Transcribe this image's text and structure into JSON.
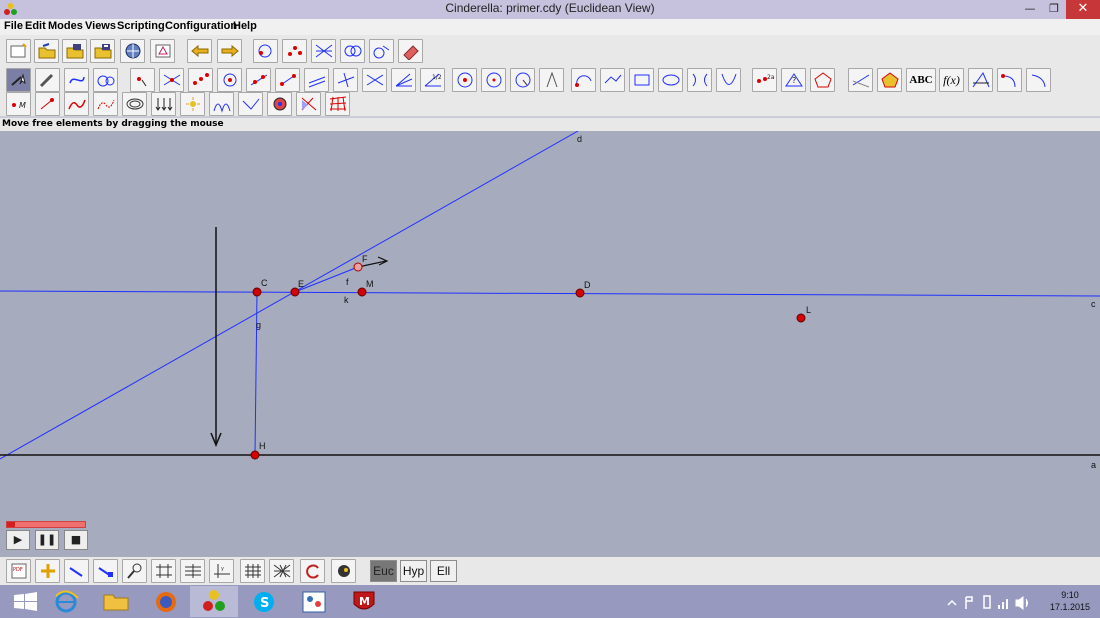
{
  "window": {
    "title": "Cinderella: primer.cdy (Euclidean View)",
    "minimize_glyph": "—",
    "maximize_glyph": "❐",
    "close_glyph": "✕"
  },
  "menu": [
    "File",
    "Edit",
    "Modes",
    "Views",
    "Scripting",
    "Configuration",
    "Help"
  ],
  "status_text": "Move free elements by dragging the mouse",
  "geometry": {
    "points": [
      "C",
      "E",
      "F",
      "M",
      "D",
      "L",
      "H"
    ],
    "labels": [
      "d",
      "c",
      "a",
      "g",
      "f",
      "k"
    ]
  },
  "animation": {
    "play_glyph": "▶",
    "pause_glyph": "❚❚",
    "stop_glyph": "■"
  },
  "bottom_text_tools": [
    "ABC",
    "f(x)"
  ],
  "geometry_modes": [
    {
      "label": "Euc",
      "active": true
    },
    {
      "label": "Hyp",
      "active": false
    },
    {
      "label": "Ell",
      "active": false
    }
  ],
  "clock": {
    "time": "9:10",
    "date": "17.1.2015"
  },
  "colors": {
    "canvas": "#a6acbe",
    "line_blue": "#1a1aff",
    "point_red": "#d20000",
    "close_red": "#c7373a"
  }
}
